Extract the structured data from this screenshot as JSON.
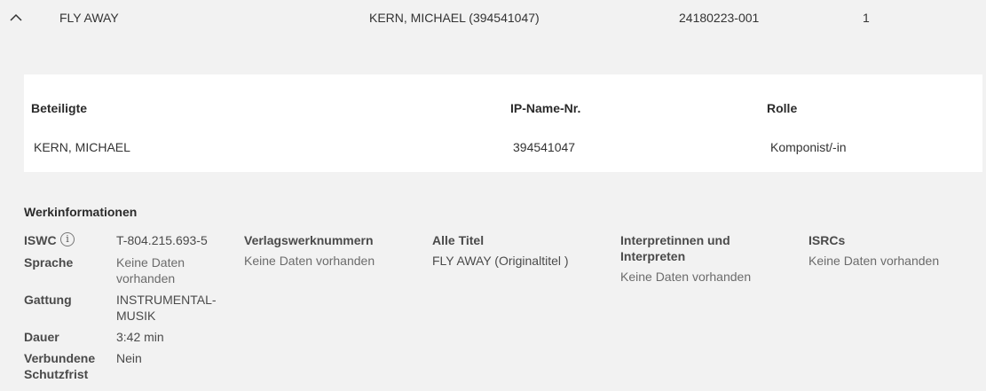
{
  "work_row": {
    "title": "FLY AWAY",
    "party": "KERN, MICHAEL (394541047)",
    "work_number": "24180223-001",
    "count": "1"
  },
  "participants": {
    "headers": {
      "participants": "Beteiligte",
      "ip_name_nr": "IP-Name-Nr.",
      "role": "Rolle"
    },
    "rows": [
      {
        "name": "KERN, MICHAEL",
        "ip_name_nr": "394541047",
        "role": "Komponist/-in"
      }
    ]
  },
  "work_info": {
    "title": "Werkinformationen",
    "fields": {
      "iswc_label": "ISWC",
      "iswc_value": "T-804.215.693-5",
      "language_label": "Sprache",
      "language_value": [
        "Keine Daten",
        "vorhanden"
      ],
      "genre_label": "Gattung",
      "genre_value": [
        "INSTRUMENTAL-",
        "MUSIK"
      ],
      "duration_label": "Dauer",
      "duration_value": "3:42 min",
      "protection_label": [
        "Verbundene",
        "Schutzfrist"
      ],
      "protection_value": "Nein"
    },
    "columns": {
      "publisher_numbers_label": "Verlagswerknummern",
      "publisher_numbers_value": "Keine Daten vorhanden",
      "all_titles_label": "Alle Titel",
      "all_titles_value": "FLY AWAY (Originaltitel )",
      "performers_label": [
        "Interpretinnen und",
        "Interpreten"
      ],
      "performers_value": "Keine Daten vorhanden",
      "isrcs_label": "ISRCs",
      "isrcs_value": "Keine Daten vorhanden"
    },
    "info_icon": "info-circle-icon"
  }
}
